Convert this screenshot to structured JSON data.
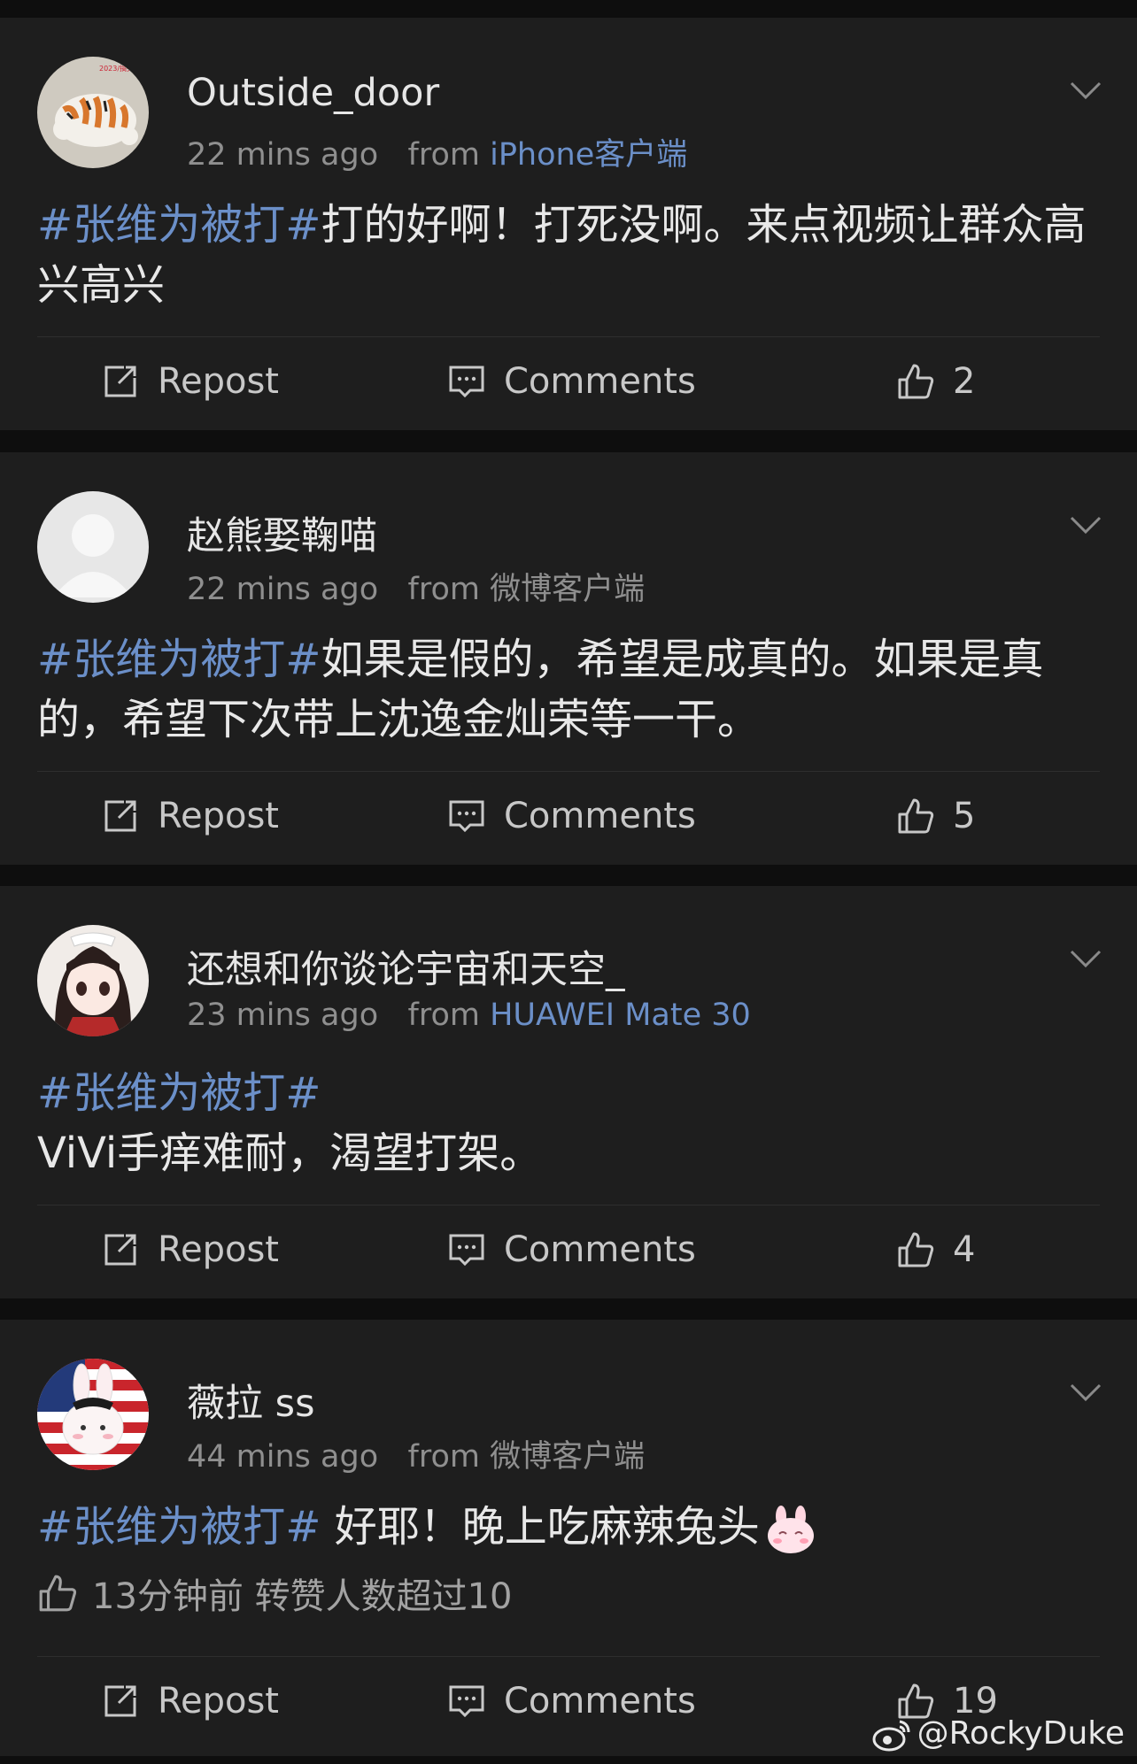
{
  "posts": [
    {
      "username": "Outside_door",
      "time": "22 mins ago",
      "from": "from",
      "source": "iPhone客户端",
      "tag": "#张维为被打#",
      "text": "打的好啊！打死没啊。来点视频让群众高兴高兴",
      "repost": "Repost",
      "comments": "Comments",
      "likes": "2",
      "avatar_icon": "tiger-avatar"
    },
    {
      "username": "赵熊娶鞠喵",
      "time": "22 mins ago",
      "from": "from",
      "source": "微博客户端",
      "tag": "#张维为被打#",
      "text": "如果是假的，希望是成真的。如果是真的，希望下次带上沈逸金灿荣等一干。",
      "repost": "Repost",
      "comments": "Comments",
      "likes": "5",
      "avatar_icon": "default-avatar"
    },
    {
      "username": "还想和你谈论宇宙和天空_",
      "time": "23 mins ago",
      "from": "from",
      "source": "HUAWEI Mate 30",
      "tag": "#张维为被打#",
      "text": "ViVi手痒难耐，渴望打架。",
      "repost": "Repost",
      "comments": "Comments",
      "likes": "4",
      "avatar_icon": "anime-girl-avatar"
    },
    {
      "username": "薇拉 ss",
      "time": "44 mins ago",
      "from": "from",
      "source": "微博客户端",
      "tag": "#张维为被打#",
      "text": " 好耶！晚上吃麻辣兔头",
      "liked_note": "13分钟前 转赞人数超过10",
      "repost": "Repost",
      "comments": "Comments",
      "likes": "19",
      "avatar_icon": "bunny-flag-avatar"
    }
  ],
  "watermark": "@RockyDuke",
  "colors": {
    "background": "#0e0e0e",
    "card": "#1e1e1e",
    "link": "#6b8fc8",
    "text": "#e8e8e8",
    "muted": "#8f8f8f"
  }
}
